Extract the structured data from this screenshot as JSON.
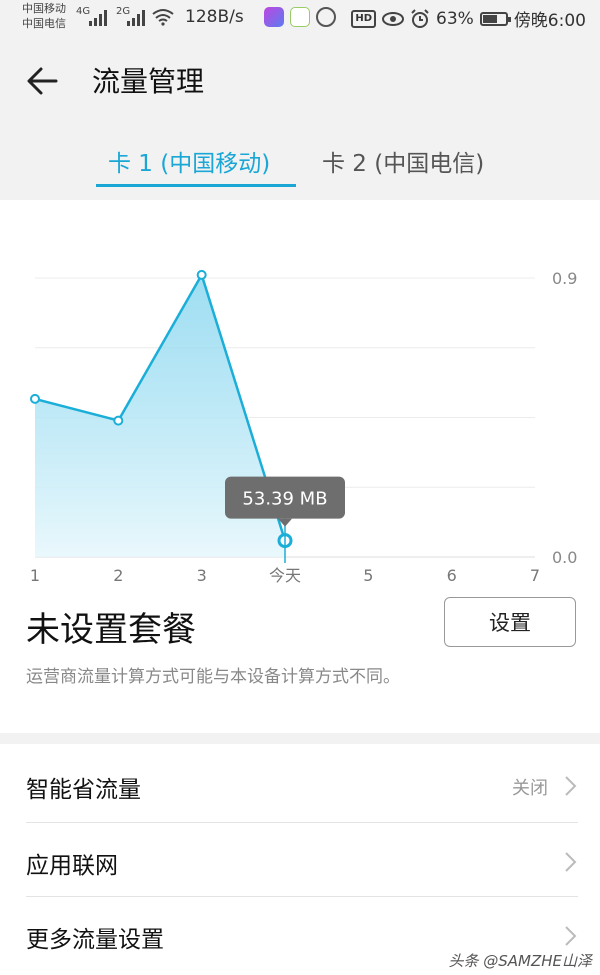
{
  "status": {
    "carrier1": "中国移动",
    "carrier2": "中国电信",
    "sig1": "4G",
    "sig2": "2G",
    "speed": "128B/s",
    "hd": "HD",
    "battery": "63%",
    "time": "傍晚6:00"
  },
  "header": {
    "title": "流量管理"
  },
  "tabs": [
    {
      "label": "卡 1 (中国移动)",
      "active": true
    },
    {
      "label": "卡 2 (中国电信)",
      "active": false
    }
  ],
  "chart_data": {
    "type": "area",
    "x": [
      "1",
      "2",
      "3",
      "今天",
      "5",
      "6",
      "7"
    ],
    "values": [
      0.51,
      0.44,
      0.91,
      0.053,
      null,
      null,
      null
    ],
    "y_ticks": [
      "0.9",
      "0.0"
    ],
    "ylim": [
      0,
      0.9
    ],
    "grid": true,
    "tooltip": "53.39 MB",
    "highlight_index": 3,
    "color": "#1aaed8"
  },
  "plan": {
    "title": "未设置套餐",
    "set_label": "设置",
    "note": "运营商流量计算方式可能与本设备计算方式不同。"
  },
  "list": [
    {
      "label": "智能省流量",
      "value": "关闭"
    },
    {
      "label": "应用联网",
      "value": ""
    },
    {
      "label": "更多流量设置",
      "value": ""
    }
  ],
  "watermark": "头条 @SAMZHE山泽",
  "colors": {
    "accent": "#1aa7d5"
  }
}
